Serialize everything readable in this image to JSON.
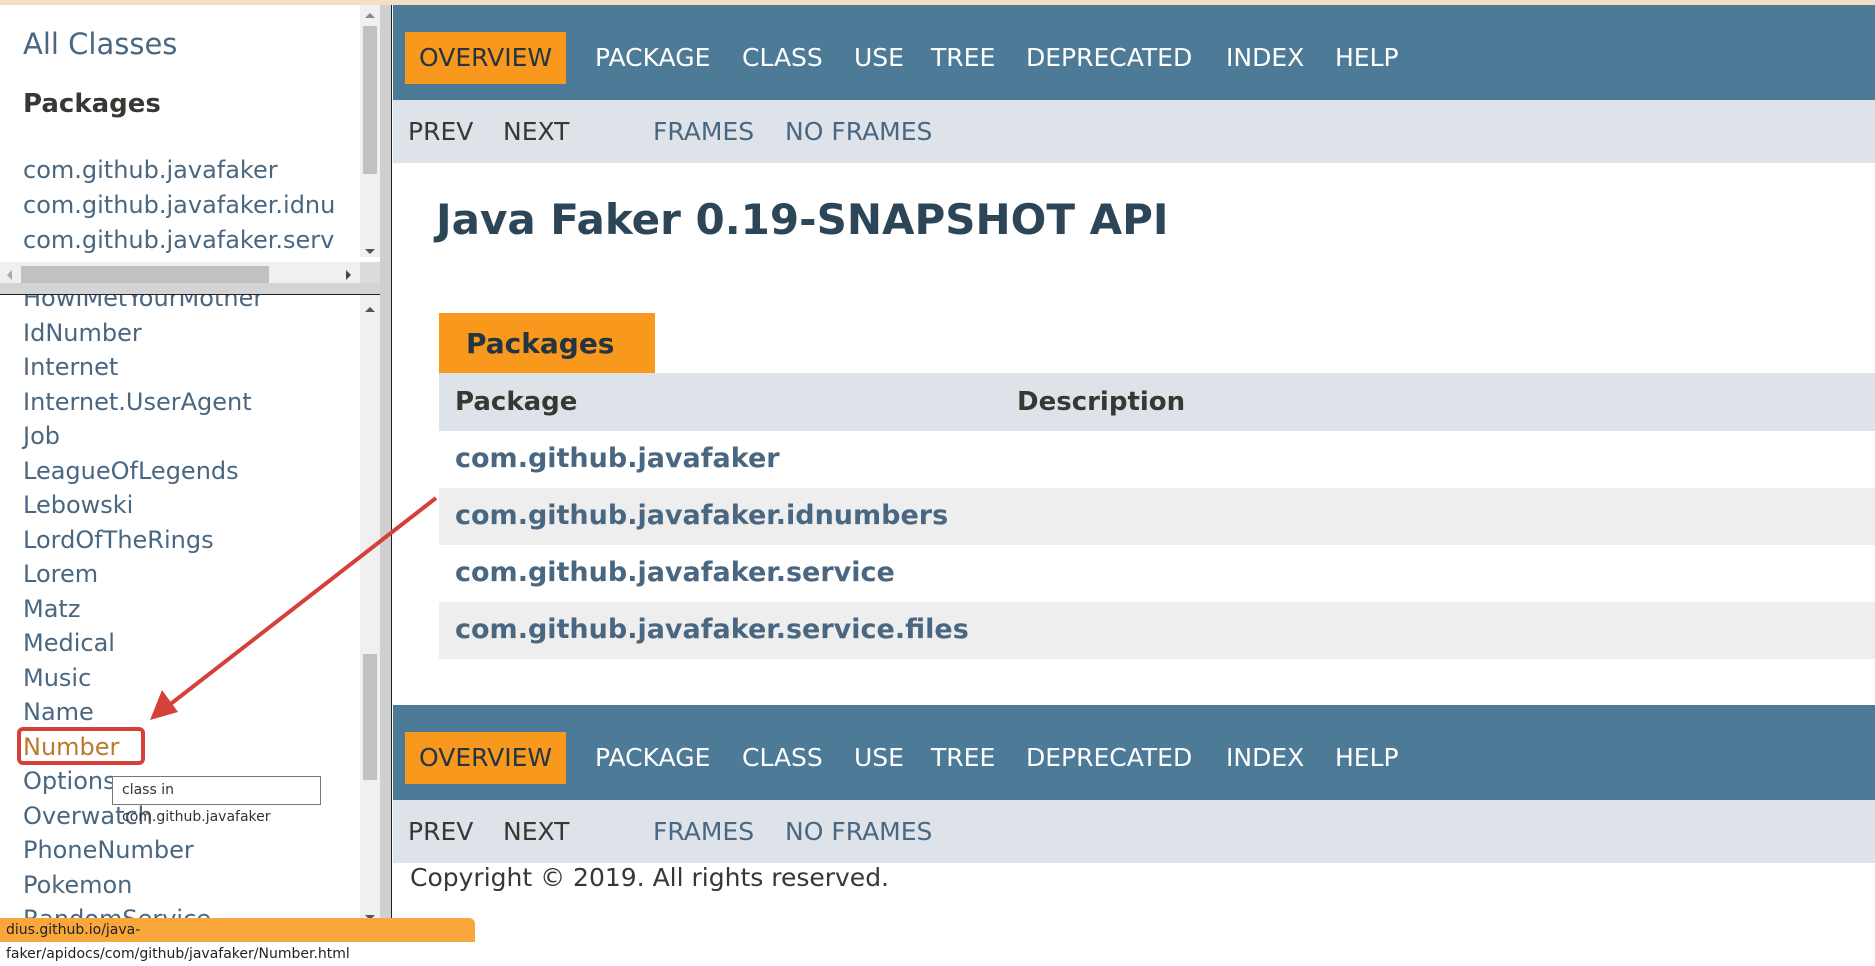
{
  "left_frame": {
    "title": "All Classes",
    "packages_heading": "Packages",
    "packages": [
      "com.github.javafaker",
      "com.github.javafaker.idnu",
      "com.github.javafaker.serv",
      "com.github.javafaker.service.files"
    ],
    "classes": [
      "HowIMetYourMother",
      "IdNumber",
      "Internet",
      "Internet.UserAgent",
      "Job",
      "LeagueOfLegends",
      "Lebowski",
      "LordOfTheRings",
      "Lorem",
      "Matz",
      "Medical",
      "Music",
      "Name",
      "Number",
      "Options",
      "Overwatch",
      "PhoneNumber",
      "Pokemon",
      "RandomService"
    ],
    "hovered_class": "Number",
    "tooltip": "class in com.github.javafaker"
  },
  "nav": {
    "items": [
      "OVERVIEW",
      "PACKAGE",
      "CLASS",
      "USE",
      "TREE",
      "DEPRECATED",
      "INDEX",
      "HELP"
    ],
    "active": "OVERVIEW"
  },
  "subnav": {
    "prev": "PREV",
    "next": "NEXT",
    "frames": "FRAMES",
    "no_frames": "NO FRAMES"
  },
  "main": {
    "title": "Java Faker 0.19-SNAPSHOT API",
    "caption": "Packages",
    "columns": [
      "Package",
      "Description"
    ],
    "rows": [
      {
        "package": "com.github.javafaker",
        "description": ""
      },
      {
        "package": "com.github.javafaker.idnumbers",
        "description": ""
      },
      {
        "package": "com.github.javafaker.service",
        "description": ""
      },
      {
        "package": "com.github.javafaker.service.files",
        "description": ""
      }
    ],
    "copyright": "Copyright © 2019. All rights reserved."
  },
  "status_bar": {
    "url": "dius.github.io/java-faker/apidocs/com/github/javafaker/Number.html"
  },
  "colors": {
    "nav_bg": "#4d7a97",
    "accent_orange": "#f8981d",
    "subnav_bg": "#dee3e9",
    "link": "#4a6782",
    "annotation_red": "#d6403a"
  }
}
